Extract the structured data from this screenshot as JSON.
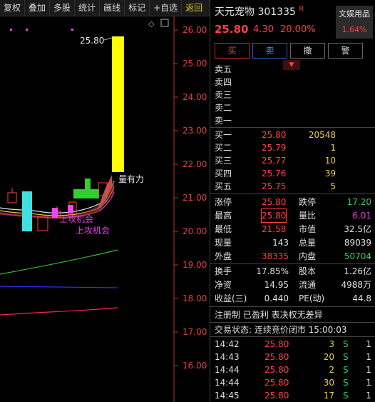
{
  "toolbar": {
    "buttons": [
      "复权",
      "叠加",
      "多股",
      "统计",
      "画线",
      "标记",
      "+自选"
    ],
    "back_label": "返回"
  },
  "chart": {
    "y_ticks": [
      "26.00",
      "25.00",
      "24.00",
      "23.00",
      "22.00",
      "21.00",
      "20.00",
      "19.00",
      "18.00",
      "17.00",
      "16.00"
    ],
    "price_label": "25.80",
    "annotations": [
      "量有力",
      "上攻机会",
      "上攻机会"
    ],
    "colors": {
      "up": "#ff4040",
      "down": "#40e0e0",
      "limit_up": "#ffff00",
      "ma_white": "#e8e8e8",
      "ma_green": "#30c030",
      "ma_blue": "#3030ff",
      "ma_red": "#ff2050",
      "signal": "#ff40ff"
    }
  },
  "header": {
    "name": "天元宠物",
    "code": "301335",
    "flag": "R",
    "price": "25.80",
    "change": "4.30",
    "change_pct": "20.00%",
    "sector_name": "文娱用品",
    "sector_pct": "1.64%"
  },
  "trade_buttons": [
    "买",
    "卖",
    "撤",
    "警"
  ],
  "sell_levels": [
    "卖五",
    "卖四",
    "卖三",
    "卖二",
    "卖一"
  ],
  "buy_levels": [
    {
      "label": "买一",
      "price": "25.80",
      "volume": "20548"
    },
    {
      "label": "买二",
      "price": "25.79",
      "volume": "1"
    },
    {
      "label": "买三",
      "price": "25.77",
      "volume": "10"
    },
    {
      "label": "买四",
      "price": "25.76",
      "volume": "39"
    },
    {
      "label": "买五",
      "price": "25.75",
      "volume": "5"
    }
  ],
  "stats": {
    "limit_up_label": "涨停",
    "limit_up": "25.80",
    "limit_down_label": "跌停",
    "limit_down": "17.20",
    "high_label": "最高",
    "high": "25.80",
    "vol_ratio_label": "量比",
    "vol_ratio": "6.01",
    "low_label": "最低",
    "low": "21.58",
    "mkt_cap_label": "市值",
    "mkt_cap": "32.5亿",
    "last_vol_label": "现量",
    "last_vol": "143",
    "total_vol_label": "总量",
    "total_vol": "89039",
    "outer_label": "外盘",
    "outer": "38335",
    "inner_label": "内盘",
    "inner": "50704",
    "turnover_label": "换手",
    "turnover": "17.85%",
    "equity_label": "股本",
    "equity": "1.26亿",
    "nav_label": "净资",
    "nav": "14.95",
    "float_label": "流通",
    "float": "4988万",
    "eps_label": "收益(三)",
    "eps": "0.440",
    "pe_label": "PE(动)",
    "pe": "44.8"
  },
  "info_line": "注册制 已盈利 表决权无差异",
  "status_line": "交易状态: 连续竞价闭市 15:00:03",
  "ticks": [
    {
      "time": "14:42",
      "price": "25.80",
      "vol": "3",
      "side": "S",
      "n": "1"
    },
    {
      "time": "14:43",
      "price": "25.80",
      "vol": "20",
      "side": "S",
      "n": "1"
    },
    {
      "time": "14:44",
      "price": "25.80",
      "vol": "2",
      "side": "S",
      "n": "1"
    },
    {
      "time": "14:44",
      "price": "25.80",
      "vol": "30",
      "side": "S",
      "n": "1"
    },
    {
      "time": "14:45",
      "price": "25.80",
      "vol": "17",
      "side": "S",
      "n": "1"
    }
  ]
}
